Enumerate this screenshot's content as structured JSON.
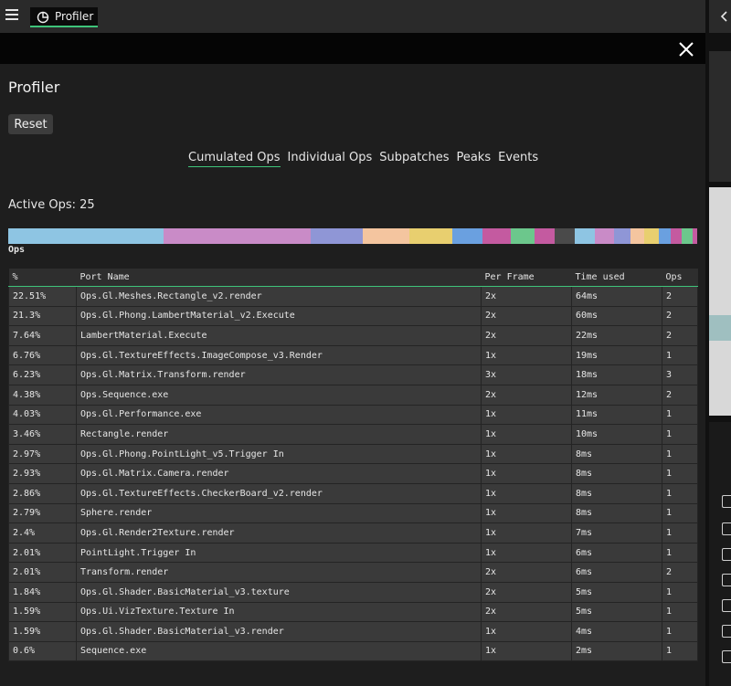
{
  "header": {
    "tab_label": "Profiler"
  },
  "panel": {
    "title": "Profiler",
    "reset_label": "Reset",
    "tabs": [
      "Cumulated Ops",
      "Individual Ops",
      "Subpatches",
      "Peaks",
      "Events"
    ],
    "active_tab": "Cumulated Ops",
    "active_ops_label": "Active Ops: 25",
    "ops_label": "Ops"
  },
  "colorbar": [
    {
      "color": "#8ec5e3",
      "pct": 22.51
    },
    {
      "color": "#c98bc7",
      "pct": 21.3
    },
    {
      "color": "#8f96d6",
      "pct": 7.64
    },
    {
      "color": "#f4c59f",
      "pct": 6.76
    },
    {
      "color": "#e8cf6f",
      "pct": 6.23
    },
    {
      "color": "#6aa0e0",
      "pct": 4.38
    },
    {
      "color": "#c45aa0",
      "pct": 4.03
    },
    {
      "color": "#6cc78c",
      "pct": 3.46
    },
    {
      "color": "#c45aa0",
      "pct": 2.97
    },
    {
      "color": "#4a4a4a",
      "pct": 2.93
    },
    {
      "color": "#8ec5e3",
      "pct": 2.86
    },
    {
      "color": "#c98bc7",
      "pct": 2.79
    },
    {
      "color": "#8f96d6",
      "pct": 2.4
    },
    {
      "color": "#f4c59f",
      "pct": 2.01
    },
    {
      "color": "#e8cf6f",
      "pct": 2.01
    },
    {
      "color": "#6aa0e0",
      "pct": 1.84
    },
    {
      "color": "#c45aa0",
      "pct": 1.59
    },
    {
      "color": "#6cc78c",
      "pct": 1.59
    },
    {
      "color": "#c45aa0",
      "pct": 0.6
    }
  ],
  "table": {
    "headers": [
      "%",
      "Port Name",
      "Per Frame",
      "Time used",
      "Ops"
    ],
    "rows": [
      [
        "22.51%",
        "Ops.Gl.Meshes.Rectangle_v2.render",
        "2x",
        "64ms",
        "2"
      ],
      [
        "21.3%",
        "Ops.Gl.Phong.LambertMaterial_v2.Execute",
        "2x",
        "60ms",
        "2"
      ],
      [
        "7.64%",
        "LambertMaterial.Execute",
        "2x",
        "22ms",
        "2"
      ],
      [
        "6.76%",
        "Ops.Gl.TextureEffects.ImageCompose_v3.Render",
        "1x",
        "19ms",
        "1"
      ],
      [
        "6.23%",
        "Ops.Gl.Matrix.Transform.render",
        "3x",
        "18ms",
        "3"
      ],
      [
        "4.38%",
        "Ops.Sequence.exe",
        "2x",
        "12ms",
        "2"
      ],
      [
        "4.03%",
        "Ops.Gl.Performance.exe",
        "1x",
        "11ms",
        "1"
      ],
      [
        "3.46%",
        "Rectangle.render",
        "1x",
        "10ms",
        "1"
      ],
      [
        "2.97%",
        "Ops.Gl.Phong.PointLight_v5.Trigger In",
        "1x",
        "8ms",
        "1"
      ],
      [
        "2.93%",
        "Ops.Gl.Matrix.Camera.render",
        "1x",
        "8ms",
        "1"
      ],
      [
        "2.86%",
        "Ops.Gl.TextureEffects.CheckerBoard_v2.render",
        "1x",
        "8ms",
        "1"
      ],
      [
        "2.79%",
        "Sphere.render",
        "1x",
        "8ms",
        "1"
      ],
      [
        "2.4%",
        "Ops.Gl.Render2Texture.render",
        "1x",
        "7ms",
        "1"
      ],
      [
        "2.01%",
        "PointLight.Trigger In",
        "1x",
        "6ms",
        "1"
      ],
      [
        "2.01%",
        "Transform.render",
        "2x",
        "6ms",
        "2"
      ],
      [
        "1.84%",
        "Ops.Gl.Shader.BasicMaterial_v3.texture",
        "2x",
        "5ms",
        "1"
      ],
      [
        "1.59%",
        "Ops.Ui.VizTexture.Texture In",
        "2x",
        "5ms",
        "1"
      ],
      [
        "1.59%",
        "Ops.Gl.Shader.BasicMaterial_v3.render",
        "1x",
        "4ms",
        "1"
      ],
      [
        "0.6%",
        "Sequence.exe",
        "1x",
        "2ms",
        "1"
      ]
    ]
  }
}
